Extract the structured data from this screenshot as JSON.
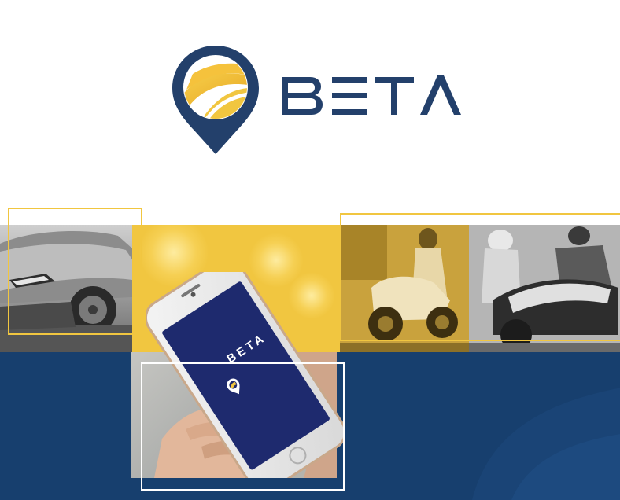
{
  "brand": {
    "name": "BETA",
    "colors": {
      "navy": "#23406b",
      "yellow": "#f1c640",
      "dark_navy_band": "#173f6e",
      "phone_screen": "#1e2a6e"
    }
  },
  "phone_screen": {
    "brand_name": "BETA"
  },
  "images": {
    "car": "car-photo",
    "scooters": "scooter-riders-photo",
    "hand": "hand-holding-phone-photo"
  }
}
